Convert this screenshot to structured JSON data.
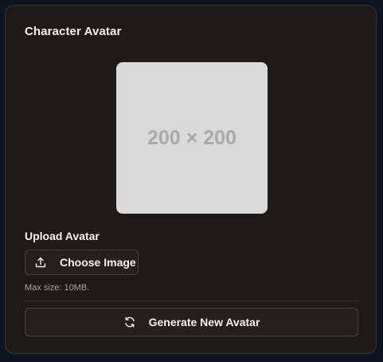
{
  "card": {
    "title": "Character Avatar"
  },
  "avatar": {
    "placeholder_text": "200 × 200"
  },
  "upload": {
    "label": "Upload Avatar",
    "choose_button_label": "Choose Image",
    "choose_button_icon": "upload-icon",
    "max_size_text": "Max size: 10MB."
  },
  "generate": {
    "button_label": "Generate New Avatar",
    "button_icon": "refresh-icon"
  },
  "colors": {
    "page_background": "#0f1520",
    "card_background": "#1e1a17",
    "card_border": "#3a3531",
    "button_background": "#24201d",
    "button_border": "#48433f",
    "text_primary": "#f3f1ee",
    "text_muted": "#a8a29c",
    "placeholder_background": "#dadada",
    "placeholder_text": "#a9a9a9"
  }
}
